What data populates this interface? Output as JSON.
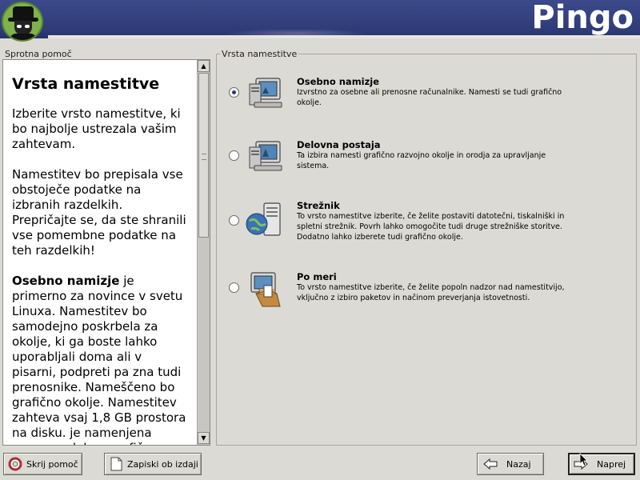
{
  "header": {
    "brand": "Pingo",
    "logo_icon": "shadowman-logo-icon"
  },
  "help": {
    "frame_title": "Sprotna pomoč",
    "heading": "Vrsta namestitve",
    "para1": "Izberite vrsto namestitve, ki bo najbolje ustrezala vašim zahtevam.",
    "para2": "Namestitev bo prepisala vse obstoječe podatke na izbranih razdelkih. Prepričajte se, da ste shranili vse pomembne podatke na teh razdelkih!",
    "para3_bold": "Osebno namizje",
    "para3_rest": " je primerno za novince v svetu Linuxa. Namestitev bo samodejno poskrbela za okolje, ki ga boste lahko uporabljali doma ali v pisarni, podpreti pa zna tudi prenosnike. Nameščeno bo grafično okolje. Namestitev zahteva vsaj 1,8 GB prostora na disku. je namenjena resnemu delu v grafičnem okolju, vključno z razvojnimi"
  },
  "main": {
    "frame_title": "Vrsta namestitve",
    "options": [
      {
        "title": "Osebno namizje",
        "desc": "Izvrstno za osebne ali prenosne računalnike. Namesti se tudi grafično okolje.",
        "selected": true,
        "icon": "personal-desktop-icon"
      },
      {
        "title": "Delovna postaja",
        "desc": "Ta izbira namesti grafično razvojno okolje in orodja za upravljanje sistema.",
        "selected": false,
        "icon": "workstation-icon"
      },
      {
        "title": "Strežnik",
        "desc": "To vrsto namestitve izberite, če želite postaviti datotečni, tiskalniški in spletni strežnik. Povrh lahko omogočite tudi druge strežniške storitve. Dodatno lahko izberete tudi grafično okolje.",
        "selected": false,
        "icon": "server-icon"
      },
      {
        "title": "Po meri",
        "desc": "To vrsto namestitve izberite, če želite popoln nadzor nad namestitvijo, vključno z izbiro paketov in načinom preverjanja istovetnosti.",
        "selected": false,
        "icon": "custom-package-icon"
      }
    ]
  },
  "footer": {
    "hide_help": "Skrij pomoč",
    "release_notes": "Zapiski ob izdaji",
    "back": "Nazaj",
    "next": "Naprej"
  },
  "colors": {
    "banner": "#2e3b78",
    "background": "#dcdad5",
    "radio_dot": "#2b3a7a"
  }
}
